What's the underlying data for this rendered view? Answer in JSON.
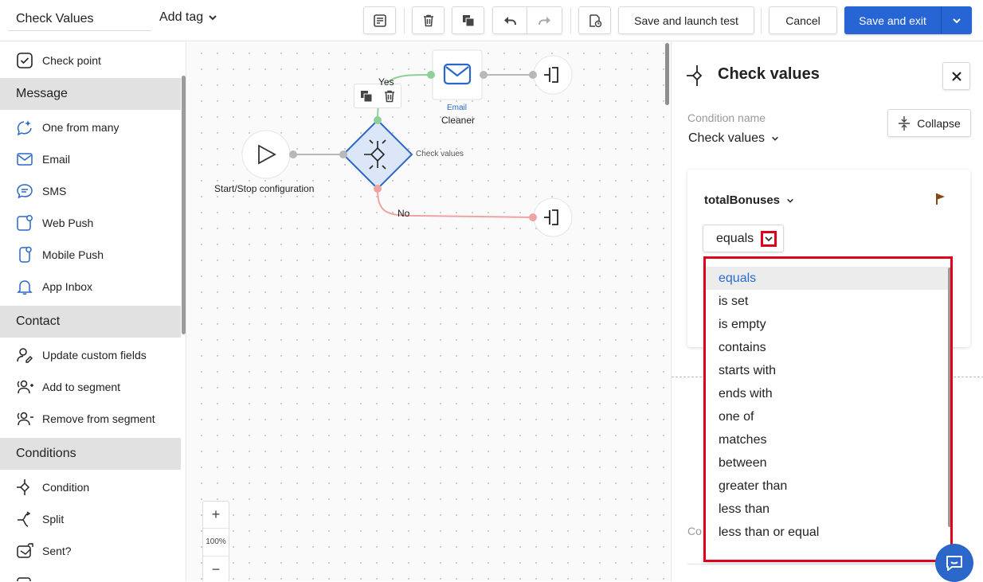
{
  "header": {
    "title_value": "Check Values",
    "add_tag": "Add tag",
    "save_launch": "Save and launch test",
    "cancel": "Cancel",
    "save_exit": "Save and exit"
  },
  "sidebar": {
    "top_item": "Check point",
    "sections": [
      {
        "title": "Message",
        "items": [
          "One from many",
          "Email",
          "SMS",
          "Web Push",
          "Mobile Push",
          "App Inbox"
        ]
      },
      {
        "title": "Contact",
        "items": [
          "Update custom fields",
          "Add to segment",
          "Remove from segment"
        ]
      },
      {
        "title": "Conditions",
        "items": [
          "Condition",
          "Split",
          "Sent?"
        ]
      }
    ]
  },
  "canvas": {
    "start_label": "Start/Stop configuration",
    "check_label": "Check values",
    "email_caption": "Email",
    "email_name": "Cleaner",
    "yes_label": "Yes",
    "no_label": "No",
    "zoom_in": "+",
    "zoom_level": "100%",
    "zoom_out": "−"
  },
  "panel": {
    "title": "Check values",
    "condition_name_label": "Condition name",
    "condition_name_value": "Check values",
    "collapse": "Collapse",
    "field_name": "totalBonuses",
    "operator": "equals",
    "cut_text": "Co"
  },
  "dropdown": {
    "options": [
      "equals",
      "is set",
      "is empty",
      "contains",
      "starts with",
      "ends with",
      "one of",
      "matches",
      "between",
      "greater than",
      "less than",
      "less than or equal"
    ]
  },
  "colors": {
    "primary": "#2764d4",
    "highlight_red": "#e0001b",
    "yes_green": "#8fd09a",
    "no_red": "#f0a3a3"
  }
}
